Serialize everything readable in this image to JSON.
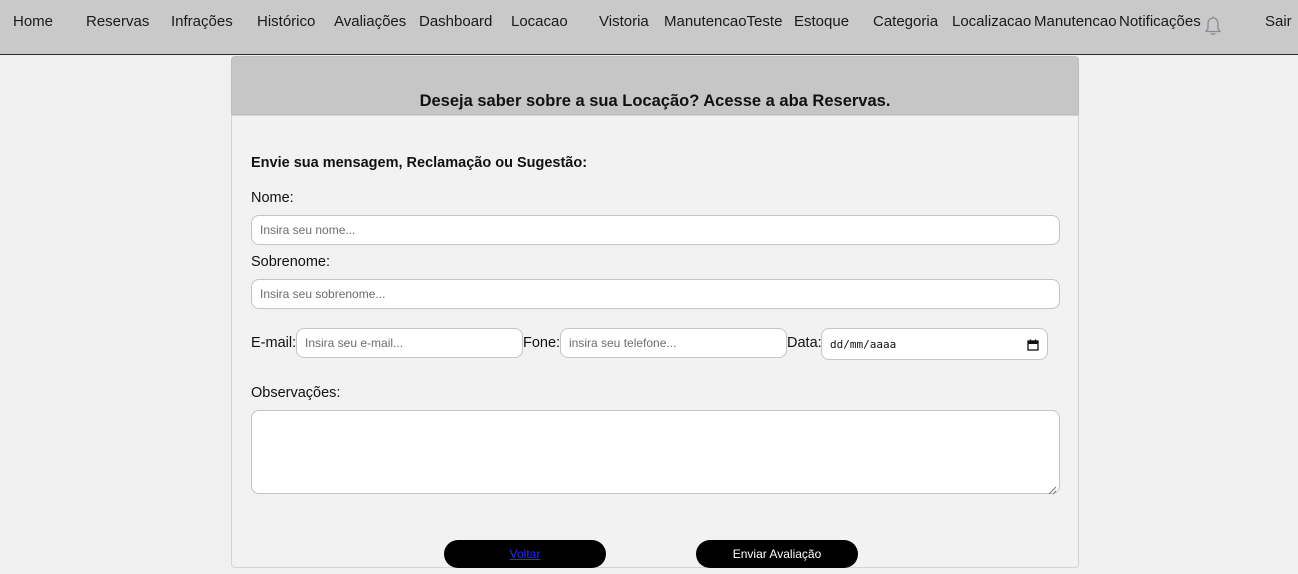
{
  "nav": {
    "items": [
      {
        "label": "Home"
      },
      {
        "label": "Reservas"
      },
      {
        "label": "Infrações"
      },
      {
        "label": "Histórico"
      },
      {
        "label": "Avaliações"
      },
      {
        "label": "Dashboard"
      },
      {
        "label": "Locacao"
      },
      {
        "label": "Vistoria"
      },
      {
        "label": "ManutencaoTeste"
      },
      {
        "label": "Estoque"
      },
      {
        "label": "Categoria"
      },
      {
        "label": "Localizacao"
      },
      {
        "label": "Manutencao"
      },
      {
        "label": "Notificações"
      }
    ],
    "bell_icon": "bell-icon",
    "logout": "Sair"
  },
  "hero": {
    "title": "Deseja saber sobre a sua Locação? Acesse a aba Reservas."
  },
  "form": {
    "heading": "Envie sua mensagem, Reclamação ou Sugestão:",
    "nome": {
      "label": "Nome:",
      "placeholder": "Insira seu nome...",
      "value": ""
    },
    "sobrenome": {
      "label": "Sobrenome:",
      "placeholder": "Insira seu sobrenome...",
      "value": ""
    },
    "email": {
      "label": "E-mail:",
      "placeholder": "Insira seu e-mail...",
      "value": ""
    },
    "fone": {
      "label": "Fone:",
      "placeholder": "insira seu telefone...",
      "value": ""
    },
    "data": {
      "label": "Data:",
      "placeholder": "dd/mm/aaaa",
      "icon": "calendar-icon"
    },
    "observacoes": {
      "label": "Observações:",
      "value": ""
    },
    "back_button": "Voltar",
    "submit_button": "Enviar Avaliação"
  }
}
